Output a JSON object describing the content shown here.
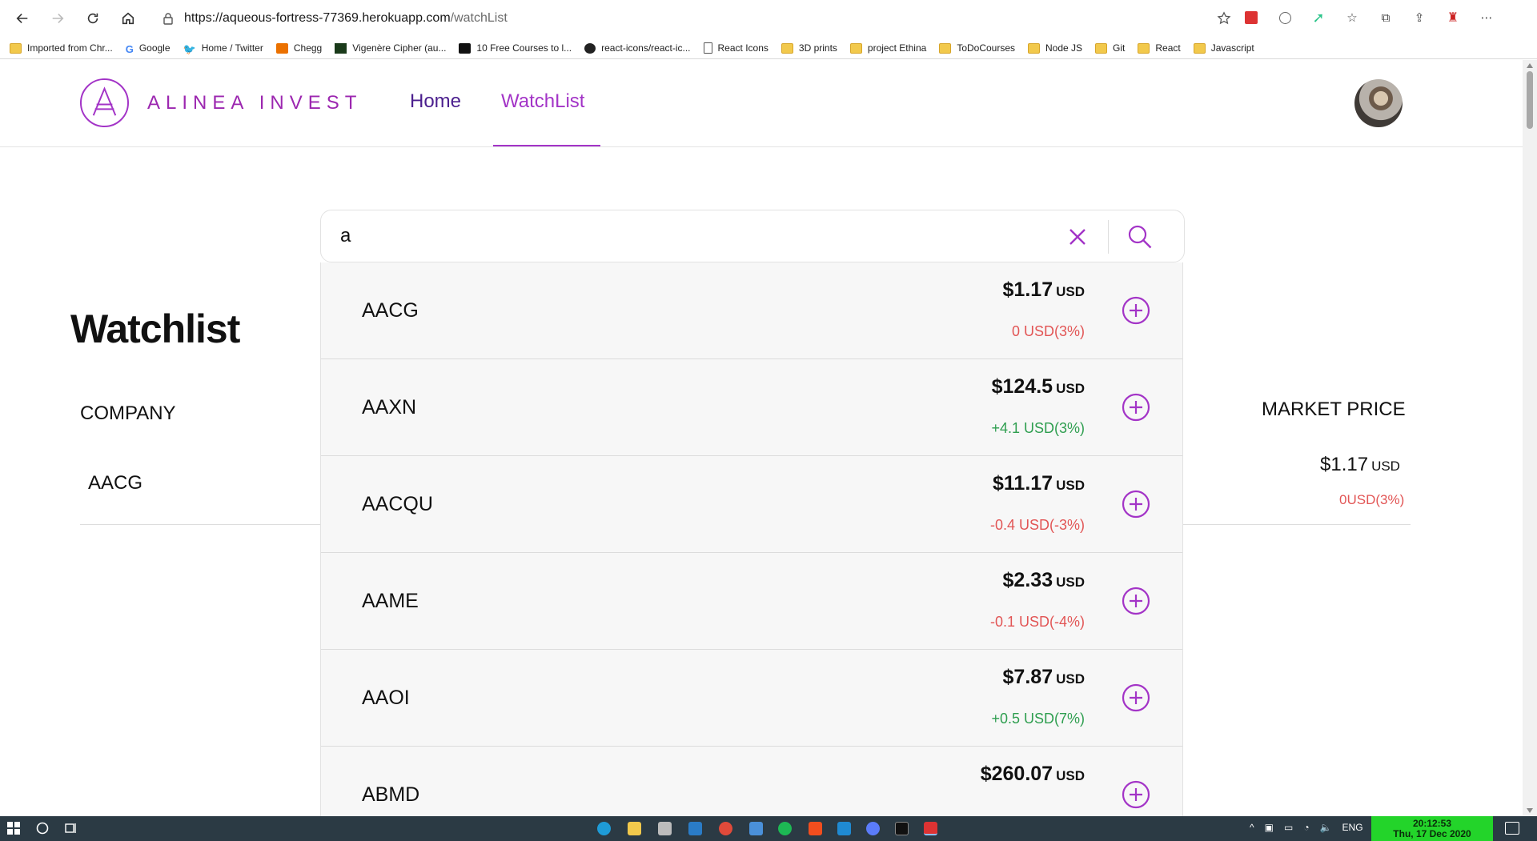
{
  "browser": {
    "url_host": "https://aqueous-fortress-77369.herokuapp.com",
    "url_path": "/watchList",
    "bookmarks": [
      {
        "label": "Imported from Chr...",
        "icon": "folder-icon"
      },
      {
        "label": "Google",
        "icon": "google-icon"
      },
      {
        "label": "Home / Twitter",
        "icon": "twitter-icon"
      },
      {
        "label": "Chegg",
        "icon": "chegg-icon"
      },
      {
        "label": "Vigenère Cipher (au...",
        "icon": "cipher-icon"
      },
      {
        "label": "10 Free Courses to l...",
        "icon": "medium-icon"
      },
      {
        "label": "react-icons/react-ic...",
        "icon": "github-icon"
      },
      {
        "label": "React Icons",
        "icon": "page-icon"
      },
      {
        "label": "3D prints",
        "icon": "folder-icon"
      },
      {
        "label": "project Ethina",
        "icon": "folder-icon"
      },
      {
        "label": "ToDoCourses",
        "icon": "folder-icon"
      },
      {
        "label": "Node JS",
        "icon": "folder-icon"
      },
      {
        "label": "Git",
        "icon": "folder-icon"
      },
      {
        "label": "React",
        "icon": "folder-icon"
      },
      {
        "label": "Javascript",
        "icon": "folder-icon"
      }
    ]
  },
  "header": {
    "brand": "ALINEA INVEST",
    "nav": {
      "home": "Home",
      "watchlist": "WatchList"
    },
    "accent_color": "#a334c7"
  },
  "watchlist": {
    "title": "Watchlist",
    "col_company": "COMPANY",
    "col_market_price": "MARKET PRICE",
    "rows": [
      {
        "symbol": "AACG",
        "price": "$1.17",
        "currency": "USD",
        "change": "0USD(3%)"
      }
    ]
  },
  "search": {
    "value": "a",
    "results": [
      {
        "symbol": "AACG",
        "price": "$1.17",
        "currency": "USD",
        "change": "0 USD(3%)",
        "trend": "zero"
      },
      {
        "symbol": "AAXN",
        "price": "$124.5",
        "currency": "USD",
        "change": "+4.1 USD(3%)",
        "trend": "pos"
      },
      {
        "symbol": "AACQU",
        "price": "$11.17",
        "currency": "USD",
        "change": "-0.4 USD(-3%)",
        "trend": "neg"
      },
      {
        "symbol": "AAME",
        "price": "$2.33",
        "currency": "USD",
        "change": "-0.1 USD(-4%)",
        "trend": "neg"
      },
      {
        "symbol": "AAOI",
        "price": "$7.87",
        "currency": "USD",
        "change": "+0.5 USD(7%)",
        "trend": "pos"
      },
      {
        "symbol": "ABMD",
        "price": "$260.07",
        "currency": "USD",
        "change": "",
        "trend": "pos"
      }
    ]
  },
  "taskbar": {
    "lang": "ENG",
    "time": "20:12:53",
    "date": "Thu, 17 Dec 2020"
  }
}
